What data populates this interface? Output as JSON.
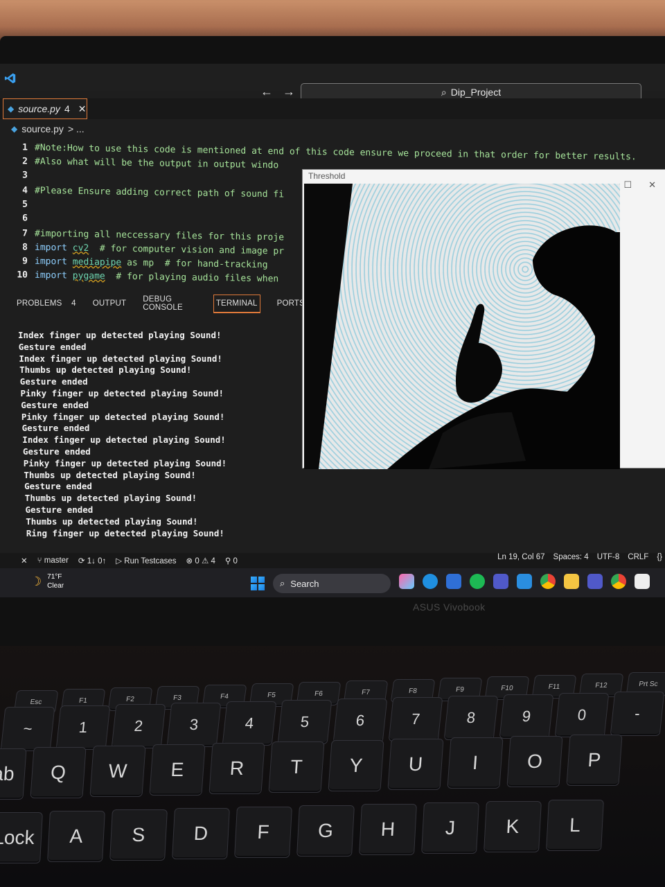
{
  "titlebar": {
    "nav_back": "←",
    "nav_forward": "→",
    "search": "Dip_Project"
  },
  "tab": {
    "name": "source.py",
    "problems_badge": "4",
    "close": "✕"
  },
  "breadcrumb": {
    "file": "source.py",
    "more": "> ..."
  },
  "editor": {
    "lines": [
      {
        "num": "1",
        "text": "#Note:How to use this code is mentioned at end of this code ensure we proceed in that order for better results."
      },
      {
        "num": "2",
        "text": "#Also what will be the output in output windo"
      },
      {
        "num": "3",
        "text": ""
      },
      {
        "num": "4",
        "text": "#Please Ensure adding correct path of sound fi"
      },
      {
        "num": "5",
        "text": ""
      },
      {
        "num": "6",
        "text": ""
      },
      {
        "num": "7",
        "text": "#importing all neccessary files for this proje"
      },
      {
        "num": "8",
        "kw": "import",
        "mod": "cv2",
        "rest": "  # for computer vision and image pr"
      },
      {
        "num": "9",
        "kw": "import",
        "mod": "mediapipe",
        "rest": " as mp  # for hand-tracking"
      },
      {
        "num": "10",
        "kw": "import",
        "mod": "pygame",
        "rest": "  # for playing audio files when"
      }
    ]
  },
  "panel": {
    "tabs": [
      "PROBLEMS",
      "OUTPUT",
      "DEBUG CONSOLE",
      "TERMINAL",
      "PORTS"
    ],
    "problems_count": "4",
    "active": "TERMINAL"
  },
  "terminal": {
    "lines": [
      "Index finger up detected playing Sound!",
      "Gesture ended",
      "Index finger up detected playing Sound!",
      "Thumbs up detected playing Sound!",
      "Gesture ended",
      "Pinky finger up detected playing Sound!",
      "Gesture ended",
      "Pinky finger up detected playing Sound!",
      "Gesture ended",
      "Index finger up detected playing Sound!",
      "Gesture ended",
      "Pinky finger up detected playing Sound!",
      "Thumbs up detected playing Sound!",
      "Gesture ended",
      "Thumbs up detected playing Sound!",
      "Gesture ended",
      "Thumbs up detected playing Sound!",
      "Ring finger up detected playing Sound!"
    ]
  },
  "threshold_window": {
    "title": "Threshold",
    "min": "—",
    "max": "☐",
    "close": "✕"
  },
  "statusbar": {
    "branch": "master",
    "sync": "1↓ 0↑",
    "run": "Run Testcases",
    "errors": "0",
    "warnings": "4",
    "ports": "0",
    "position": "Ln 19, Col 67",
    "spaces": "Spaces: 4",
    "encoding": "UTF-8",
    "eol": "CRLF",
    "lang": "{}"
  },
  "taskbar": {
    "temp": "71°F",
    "condition": "Clear",
    "search": "Search"
  },
  "brand": "ASUS Vivobook",
  "keyboard": {
    "fn_row": [
      "Esc",
      "F1",
      "F2",
      "F3",
      "F4",
      "F5",
      "F6",
      "F7",
      "F8",
      "F9",
      "F10",
      "F11",
      "F12",
      "Prt Sc"
    ],
    "num_row": [
      "~",
      "1",
      "2",
      "3",
      "4",
      "5",
      "6",
      "7",
      "8",
      "9",
      "0",
      "-"
    ],
    "top_row": [
      "Tab",
      "Q",
      "W",
      "E",
      "R",
      "T",
      "Y",
      "U",
      "I",
      "O",
      "P"
    ],
    "home_row": [
      "Lock",
      "A",
      "S",
      "D",
      "F",
      "G",
      "H",
      "J",
      "K",
      "L"
    ]
  }
}
